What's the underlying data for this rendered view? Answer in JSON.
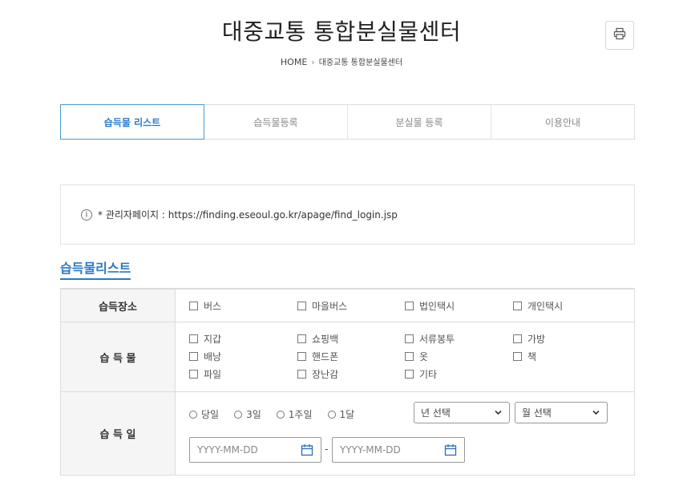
{
  "header": {
    "title": "대중교통 통합분실물센터",
    "print_icon": "printer-icon"
  },
  "breadcrumb": {
    "home": "HOME",
    "separator": "›",
    "current": "대중교통 통합분실물센터"
  },
  "tabs": [
    {
      "label": "습득물 리스트",
      "active": true
    },
    {
      "label": "습득물등록",
      "active": false
    },
    {
      "label": "분실물 등록",
      "active": false
    },
    {
      "label": "이용안내",
      "active": false
    }
  ],
  "notice": {
    "icon": "info-icon",
    "icon_glyph": "i",
    "text": "* 관리자페이지 : https://finding.eseoul.go.kr/apage/find_login.jsp"
  },
  "section": {
    "title": "습득물리스트"
  },
  "form": {
    "location": {
      "label": "습득장소",
      "options": [
        "버스",
        "마을버스",
        "법인택시",
        "개인택시"
      ]
    },
    "item": {
      "label": "습 득 물",
      "options": [
        "지갑",
        "쇼핑백",
        "서류봉투",
        "가방",
        "배낭",
        "핸드폰",
        "옷",
        "책",
        "파일",
        "장난감",
        "기타"
      ]
    },
    "date": {
      "label": "습 득 일",
      "periods": [
        "당일",
        "3일",
        "1주일",
        "1달"
      ],
      "year_select": "년 선택",
      "month_select": "월 선택",
      "start_placeholder": "YYYY-MM-DD",
      "end_placeholder": "YYYY-MM-DD",
      "range_separator": "-"
    }
  },
  "colors": {
    "accent": "#2b79c4",
    "tab_border": "#4a97d3",
    "row_head_bg": "#f5f5f5",
    "border": "#dcdcdc"
  }
}
